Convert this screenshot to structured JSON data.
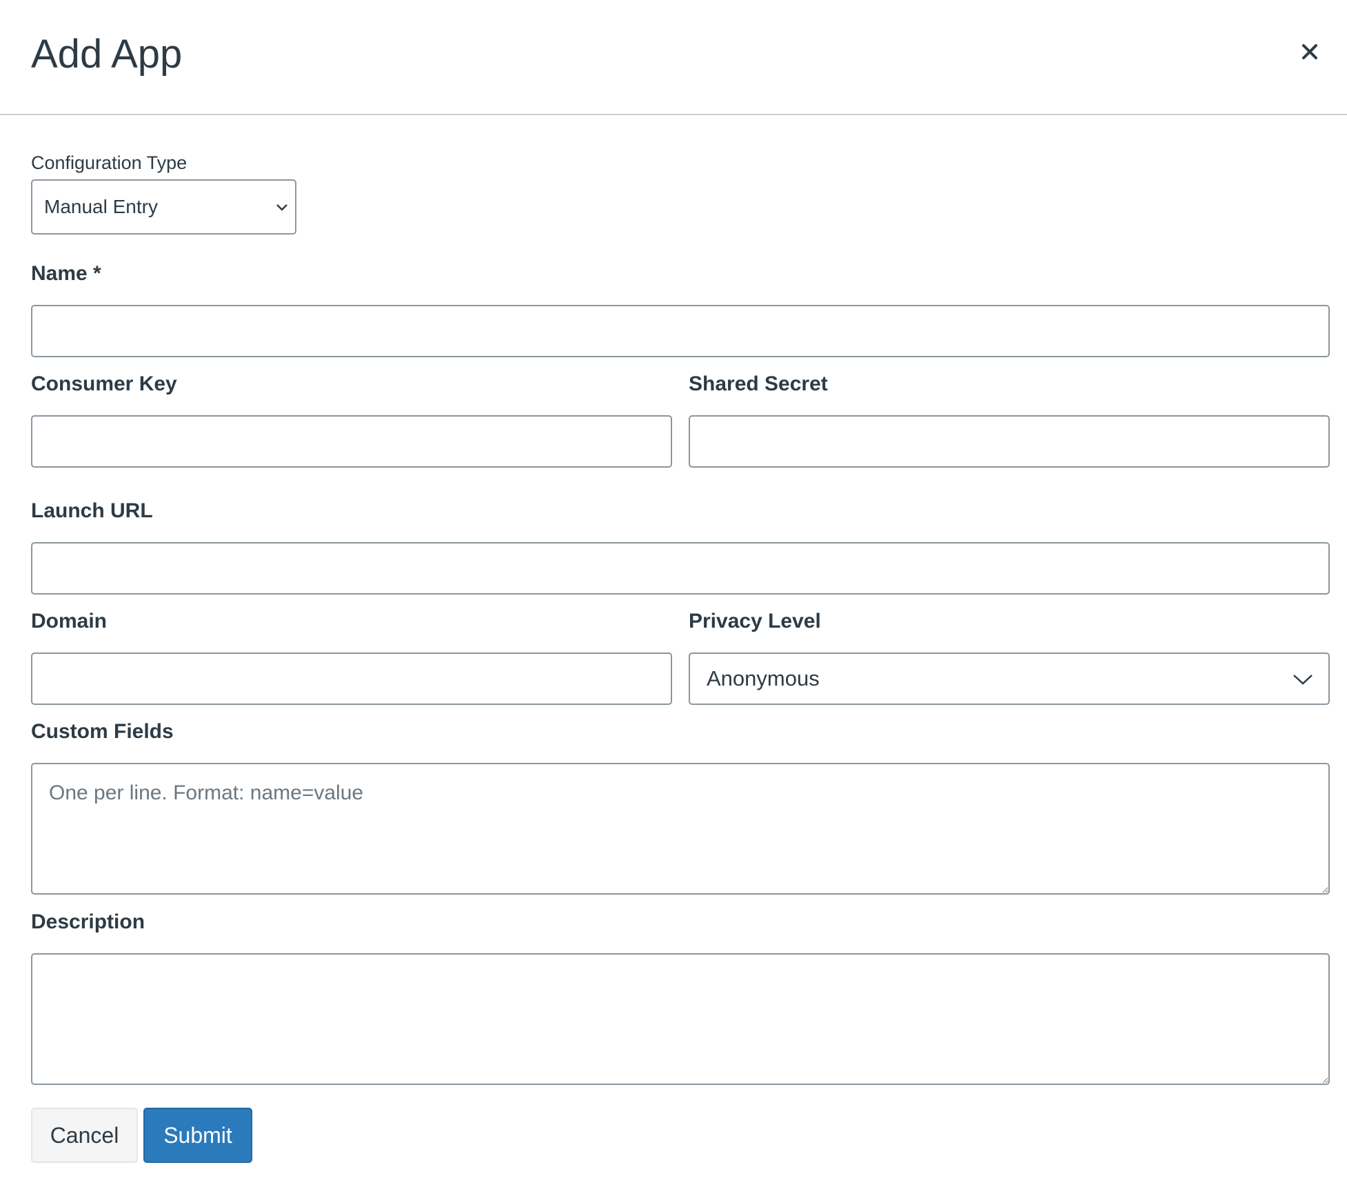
{
  "dialog": {
    "title": "Add App",
    "close_label": "×"
  },
  "form": {
    "configuration_type": {
      "label": "Configuration Type",
      "value": "Manual Entry"
    },
    "name": {
      "label": "Name *",
      "value": ""
    },
    "consumer_key": {
      "label": "Consumer Key",
      "value": ""
    },
    "shared_secret": {
      "label": "Shared Secret",
      "value": ""
    },
    "launch_url": {
      "label": "Launch URL",
      "value": ""
    },
    "domain": {
      "label": "Domain",
      "value": ""
    },
    "privacy_level": {
      "label": "Privacy Level",
      "value": "Anonymous"
    },
    "custom_fields": {
      "label": "Custom Fields",
      "placeholder": "One per line. Format: name=value"
    },
    "description": {
      "label": "Description",
      "value": ""
    }
  },
  "buttons": {
    "cancel": "Cancel",
    "submit": "Submit"
  },
  "colors": {
    "primary": "#2b7abc",
    "text": "#2d3b45",
    "border": "#8b969e"
  }
}
